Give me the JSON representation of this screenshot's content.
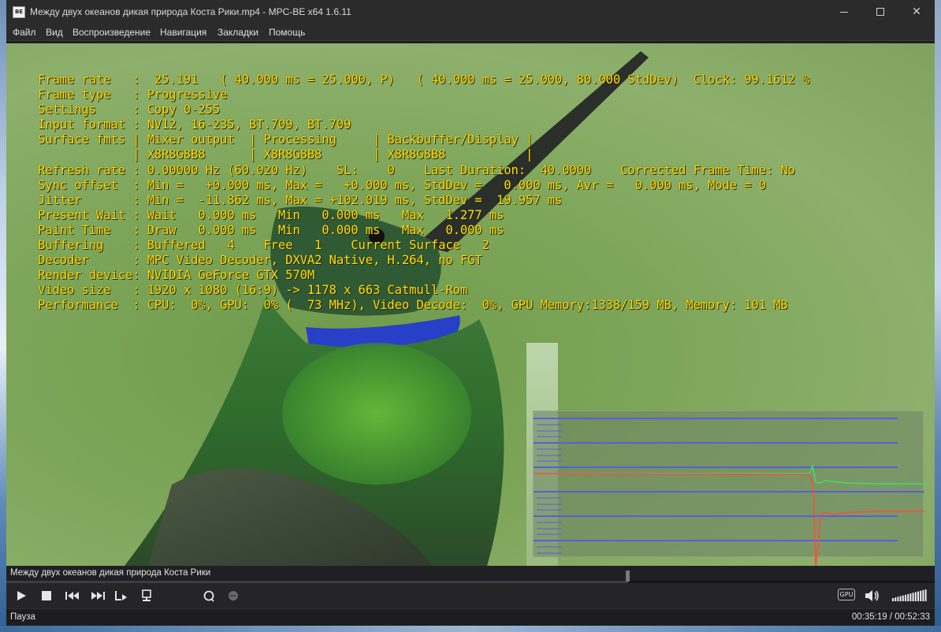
{
  "window": {
    "title": "Между двух океанов дикая природа Коста Рики.mp4 - MPC-BE x64 1.6.11",
    "app_icon_label": "BE"
  },
  "menu": [
    "Файл",
    "Вид",
    "Воспроизведение",
    "Навигация",
    "Закладки",
    "Помощь"
  ],
  "stats": {
    "lines": [
      "Frame rate   :  25.191   ( 40.000 ms = 25.000, P)   ( 40.000 ms = 25.000, 80.000 StdDev)  Clock: 99.1612 %",
      "Frame type   : Progressive",
      "Settings     : Copy 0-255",
      "Input format : NV12, 16-235, BT.709, BT.709",
      "Surface fmts | Mixer output  | Processing     | Backbuffer/Display |",
      "             | X8R8G8B8      | X8R8G8B8       | X8R8G8B8           |",
      "Refresh rate : 0.00000 Hz (60.020 Hz)    SL:    0    Last Duration:  40.0000    Corrected Frame Time: No",
      "Sync offset  : Min =   +0.000 ms, Max =   +0.000 ms, StdDev =   0.000 ms, Avr =   0.000 ms, Mode = 0",
      "Jitter       : Min =  -11.862 ms, Max = +102.019 ms, StdDev =  19.957 ms",
      "Present Wait : Wait   0.000 ms   Min   0.000 ms   Max   1.277 ms",
      "Paint Time   : Draw   0.000 ms   Min   0.000 ms   Max   0.000 ms",
      "Buffering    : Buffered   4    Free   1    Current Surface   2",
      "Decoder      : MPC Video Decoder, DXVA2 Native, H.264, no FGT",
      "Render device: NVIDIA GeForce GTX 570M",
      "Video size   : 1920 x 1080 (16:9) -> 1178 x 663 Catmull-Rom",
      "Performance  : CPU:  0%, GPU:  0% (  73 MHz), Video Decode:  0%, GPU Memory:1338/159 MB, Memory: 101 MB"
    ]
  },
  "colors": {
    "stats_text": "#ffe000",
    "graph_grid": "#5560d8",
    "graph_red": "#ff4a3a",
    "graph_green": "#40e060"
  },
  "file_label": "Между двух океанов дикая природа Коста Рики",
  "seek": {
    "position_fraction": 0.67
  },
  "controls": {
    "icons": [
      "play-icon",
      "stop-icon",
      "prev-icon",
      "next-icon",
      "frame-step-icon",
      "subtitle-icon",
      "search-icon",
      "record-icon"
    ],
    "gpu_label": "GPU",
    "volume_fraction": 1.0
  },
  "status": {
    "state": "Пауза",
    "time": "00:35:19 / 00:52:33"
  }
}
